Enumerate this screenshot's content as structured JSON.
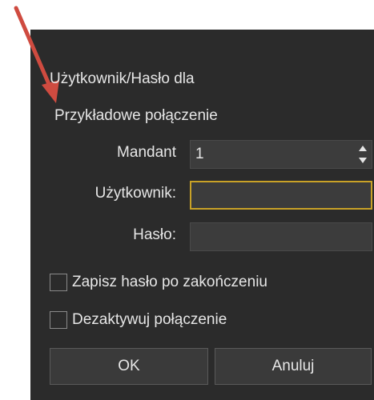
{
  "dialog": {
    "title_line": "Użytkownik/Hasło dla",
    "connection_name": "Przykładowe połączenie"
  },
  "form": {
    "mandant_label": "Mandant",
    "mandant_value": "1",
    "user_label": "Użytkownik:",
    "user_value": "",
    "password_label": "Hasło:",
    "password_value": ""
  },
  "options": {
    "save_password_label": "Zapisz hasło po zakończeniu",
    "save_password_checked": false,
    "deactivate_label": "Dezaktywuj połączenie",
    "deactivate_checked": false
  },
  "buttons": {
    "ok_label": "OK",
    "cancel_label": "Anuluj"
  },
  "colors": {
    "dialog_bg": "#2b2b2b",
    "field_bg": "#3c3c3c",
    "focus_border": "#c9a227",
    "annotation_arrow": "#cf4b40"
  }
}
